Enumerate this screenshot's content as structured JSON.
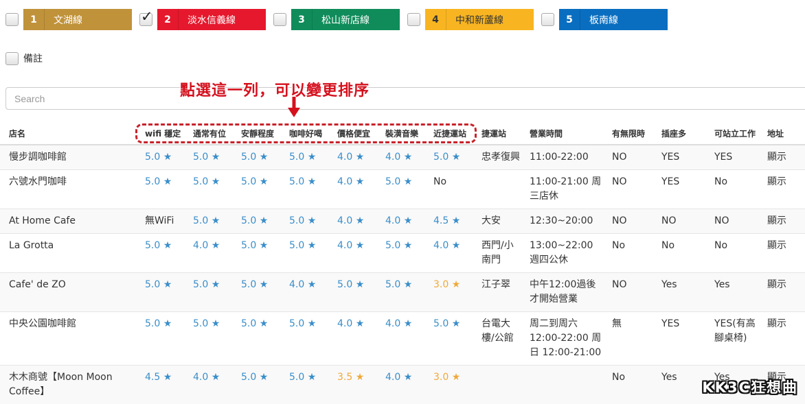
{
  "lines": [
    {
      "num": "1",
      "name": "文湖線",
      "color": "#c0923a",
      "checked": false
    },
    {
      "num": "2",
      "name": "淡水信義線",
      "color": "#e6182d",
      "checked": true
    },
    {
      "num": "3",
      "name": "松山新店線",
      "color": "#0f8c5a",
      "checked": false
    },
    {
      "num": "4",
      "name": "中和新蘆線",
      "color": "#f8b521",
      "checked": false
    },
    {
      "num": "5",
      "name": "板南線",
      "color": "#0a6ec0",
      "checked": false
    }
  ],
  "note_label": "備註",
  "search": {
    "placeholder": "Search"
  },
  "callout": "點選這一列，可以變更排序",
  "headers": [
    "店名",
    "wifi 穩定",
    "通常有位",
    "安靜程度",
    "咖啡好喝",
    "價格便宜",
    "裝潢音樂",
    "近捷運站",
    "捷運站",
    "營業時間",
    "有無限時",
    "插座多",
    "可站立工作",
    "地址"
  ],
  "rows": [
    [
      "慢步調咖啡館",
      "5.0 ★",
      "5.0 ★",
      "5.0 ★",
      "5.0 ★",
      "4.0 ★",
      "4.0 ★",
      "5.0 ★",
      "忠孝復興",
      "11:00-22:00",
      "NO",
      "YES",
      "YES",
      "顯示"
    ],
    [
      "六號水門咖啡",
      "5.0 ★",
      "5.0 ★",
      "5.0 ★",
      "5.0 ★",
      "4.0 ★",
      "5.0 ★",
      "No",
      "",
      "11:00-21:00 周三店休",
      "NO",
      "YES",
      "No",
      "顯示"
    ],
    [
      "At Home Cafe",
      "無WiFi",
      "5.0 ★",
      "5.0 ★",
      "5.0 ★",
      "4.0 ★",
      "4.0 ★",
      "4.5 ★",
      "大安",
      "12:30~20:00",
      "NO",
      "NO",
      "NO",
      "顯示"
    ],
    [
      "La Grotta",
      "5.0 ★",
      "4.0 ★",
      "5.0 ★",
      "5.0 ★",
      "4.0 ★",
      "5.0 ★",
      "4.0 ★",
      "西門/小南門",
      "13:00~22:00 週四公休",
      "No",
      "No",
      "No",
      "顯示"
    ],
    [
      "Cafe' de ZO",
      "5.0 ★",
      "5.0 ★",
      "5.0 ★",
      "4.0 ★",
      "5.0 ★",
      "5.0 ★",
      "3.0 ★",
      "江子翠",
      "中午12:00過後才開始營業",
      "NO",
      "Yes",
      "Yes",
      "顯示"
    ],
    [
      "中央公園咖啡館",
      "5.0 ★",
      "5.0 ★",
      "5.0 ★",
      "5.0 ★",
      "4.0 ★",
      "4.0 ★",
      "5.0 ★",
      "台電大樓/公館",
      "周二到周六 12:00-22:00 周日 12:00-21:00",
      "無",
      "YES",
      "YES(有高腳桌椅)",
      "顯示"
    ],
    [
      "木木商號【Moon Moon Coffee】",
      "4.5 ★",
      "4.0 ★",
      "5.0 ★",
      "5.0 ★",
      "3.5 ★",
      "4.0 ★",
      "3.0 ★",
      "",
      "",
      "No",
      "Yes",
      "Yes",
      "顯示"
    ]
  ],
  "watermark": "KK3C狂想曲"
}
